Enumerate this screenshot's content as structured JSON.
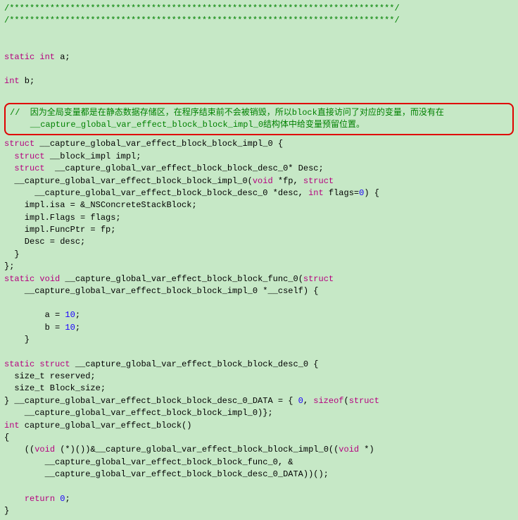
{
  "sep1": "/****************************************************************************/",
  "sep2": "/****************************************************************************/",
  "decl_a_pre": "static int",
  "decl_a_post": " a;",
  "decl_b_pre": "int",
  "decl_b_post": " b;",
  "comment_l1": "//  因为全局变量都是在静态数据存储区，在程序结束前不会被销毁，所以block直接访问了对应的变量，而没有在",
  "comment_l2": "    __capture_global_var_effect_block_block_impl_0结构体中给变量预留位置。",
  "s1_kw": "struct",
  "s1_name": " __capture_global_var_effect_block_block_impl_0 {",
  "s1_m1_kw": "struct",
  "s1_m1_post": " __block_impl impl;",
  "s1_m2_kw": "struct",
  "s1_m2_post": "  __capture_global_var_effect_block_block_desc_0* Desc;",
  "ctor_l1a": "  __capture_global_var_effect_block_block_impl_0(",
  "ctor_l1_void": "void",
  "ctor_l1b": " *fp, ",
  "ctor_l1_struct": "struct",
  "ctor_l2a": "      __capture_global_var_effect_block_block_desc_0 *desc, ",
  "ctor_l2_int": "int",
  "ctor_l2b": " flags=",
  "zero": "0",
  "ctor_l2c": ") {",
  "ctor_b1": "    impl.isa = &_NSConcreteStackBlock;",
  "ctor_b2": "    impl.Flags = flags;",
  "ctor_b3": "    impl.FuncPtr = fp;",
  "ctor_b4": "    Desc = desc;",
  "ctor_close": "  }",
  "s1_close": "};",
  "fn_static": "static",
  "fn_void": " void",
  "fn_name": " __capture_global_var_effect_block_block_func_0(",
  "fn_struct": "struct",
  "fn_l2": "    __capture_global_var_effect_block_block_impl_0 *__cself) {",
  "fn_b1a": "        a = ",
  "ten": "10",
  "fn_b1b": ";",
  "fn_b2a": "        b = ",
  "fn_b2b": ";",
  "fn_close": "    }",
  "s2_static": "static",
  "s2_struct": " struct",
  "s2_name": " __capture_global_var_effect_block_block_desc_0 {",
  "s2_m1": "  size_t reserved;",
  "s2_m2": "  size_t Block_size;",
  "s2_close_a": "} __capture_global_var_effect_block_block_desc_0_DATA = { ",
  "s2_close_b": ", ",
  "sizeof": "sizeof",
  "s2_close_c": "(",
  "s2_close_struct": "struct",
  "s2_l2": "    __capture_global_var_effect_block_block_impl_0)};",
  "main_int": "int",
  "main_name": " capture_global_var_effect_block()",
  "open_brace": "{",
  "main_b1a": "    ((",
  "main_void1": "void",
  "main_b1b": " (*)())&__capture_global_var_effect_block_block_impl_0((",
  "main_void2": "void",
  "main_b1c": " *)",
  "main_b2": "        __capture_global_var_effect_block_block_func_0, &",
  "main_b3": "        __capture_global_var_effect_block_block_desc_0_DATA))();",
  "ret_kw": "return",
  "ret_sp": "    ",
  "ret_post": " ",
  "semi": ";",
  "close_brace": "}"
}
